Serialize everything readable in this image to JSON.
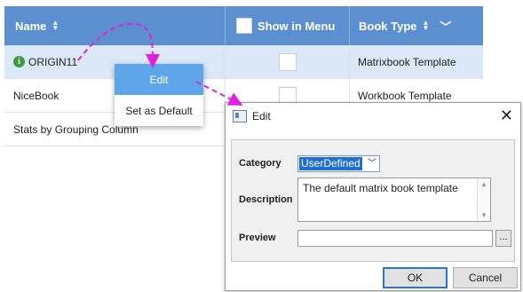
{
  "table": {
    "headers": {
      "name": "Name",
      "show_in_menu": "Show in Menu",
      "book_type": "Book Type"
    },
    "rows": [
      {
        "name": "ORIGIN11",
        "book_type": "Matrixbook Template"
      },
      {
        "name": "NiceBook",
        "book_type": "Workbook Template"
      },
      {
        "name": "Stats by Grouping Column",
        "book_type": ""
      }
    ],
    "info_icon_glyph": "i"
  },
  "context_menu": {
    "items": [
      "Edit",
      "Set as Default"
    ]
  },
  "dialog": {
    "title": "Edit",
    "close_glyph": "✕",
    "category_label": "Category",
    "category_value": "UserDefined",
    "description_label": "Description",
    "description_value": "The default matrix book template",
    "preview_label": "Preview",
    "preview_value": "",
    "browse_label": "...",
    "ok_label": "OK",
    "cancel_label": "Cancel"
  },
  "colors": {
    "header_bg": "#5b8fcf",
    "selected_row": "#dbe8f8",
    "menu_highlight": "#5fa6e8",
    "arrow": "#e020e0",
    "info_icon": "#3d9a3d"
  },
  "icons": [
    "sort-icon",
    "chevron-down-icon",
    "info-icon",
    "window-icon",
    "close-icon",
    "dropdown-arrow-icon"
  ]
}
